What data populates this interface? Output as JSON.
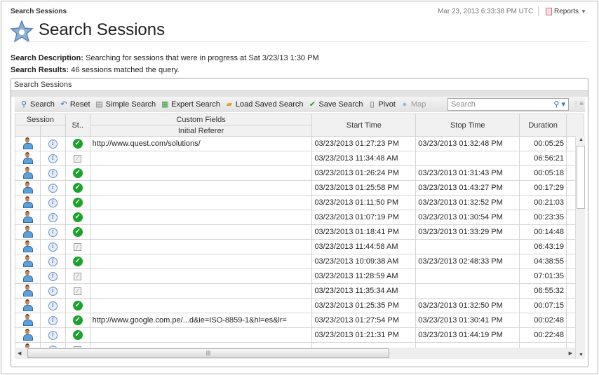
{
  "header": {
    "breadcrumb": "Search Sessions",
    "timestamp": "Mar 23, 2013 6:33:38 PM UTC",
    "reports_label": "Reports",
    "page_title": "Search Sessions"
  },
  "summary": {
    "desc_label": "Search Description:",
    "desc_value": "Searching for sessions that were in progress at Sat 3/23/13 1:30 PM",
    "results_label": "Search Results:",
    "results_value": "46 sessions matched the query."
  },
  "panel": {
    "title": "Search Sessions"
  },
  "toolbar": {
    "search": "Search",
    "reset": "Reset",
    "simple_search": "Simple Search",
    "expert_search": "Expert Search",
    "load_saved_search": "Load Saved Search",
    "save_search": "Save Search",
    "pivot": "Pivot",
    "map": "Map",
    "search_placeholder": "Search"
  },
  "columns": {
    "session": "Session",
    "status": "St..",
    "custom_fields": "Custom Fields",
    "initial_referer": "Initial Referer",
    "start_time": "Start Time",
    "stop_time": "Stop Time",
    "duration": "Duration"
  },
  "rows": [
    {
      "status": "ok",
      "referer": "http://www.quest.com/solutions/",
      "start": "03/23/2013 01:27:23 PM",
      "stop": "03/23/2013 01:32:48 PM",
      "duration": "00:05:25"
    },
    {
      "status": "pending",
      "referer": "",
      "start": "03/23/2013 11:34:48 AM",
      "stop": "",
      "duration": "06:56:21"
    },
    {
      "status": "ok",
      "referer": "",
      "start": "03/23/2013 01:26:24 PM",
      "stop": "03/23/2013 01:31:43 PM",
      "duration": "00:05:18"
    },
    {
      "status": "ok",
      "referer": "",
      "start": "03/23/2013 01:25:58 PM",
      "stop": "03/23/2013 01:43:27 PM",
      "duration": "00:17:29"
    },
    {
      "status": "ok",
      "referer": "",
      "start": "03/23/2013 01:11:50 PM",
      "stop": "03/23/2013 01:32:52 PM",
      "duration": "00:21:03"
    },
    {
      "status": "ok",
      "referer": "",
      "start": "03/23/2013 01:07:19 PM",
      "stop": "03/23/2013 01:30:54 PM",
      "duration": "00:23:35"
    },
    {
      "status": "ok",
      "referer": "",
      "start": "03/23/2013 01:18:41 PM",
      "stop": "03/23/2013 01:33:29 PM",
      "duration": "00:14:48"
    },
    {
      "status": "pending",
      "referer": "",
      "start": "03/23/2013 11:44:58 AM",
      "stop": "",
      "duration": "06:43:19"
    },
    {
      "status": "ok",
      "referer": "",
      "start": "03/23/2013 10:09:38 AM",
      "stop": "03/23/2013 02:48:33 PM",
      "duration": "04:38:55"
    },
    {
      "status": "pending",
      "referer": "",
      "start": "03/23/2013 11:28:59 AM",
      "stop": "",
      "duration": "07:01:35"
    },
    {
      "status": "pending",
      "referer": "",
      "start": "03/23/2013 11:35:34 AM",
      "stop": "",
      "duration": "06:55:32"
    },
    {
      "status": "ok",
      "referer": "",
      "start": "03/23/2013 01:25:35 PM",
      "stop": "03/23/2013 01:32:50 PM",
      "duration": "00:07:15"
    },
    {
      "status": "ok",
      "referer": "http://www.google.com.pe/...d&ie=ISO-8859-1&hl=es&lr=",
      "start": "03/23/2013 01:27:54 PM",
      "stop": "03/23/2013 01:30:41 PM",
      "duration": "00:02:48"
    },
    {
      "status": "ok",
      "referer": "",
      "start": "03/23/2013 01:21:31 PM",
      "stop": "03/23/2013 01:44:19 PM",
      "duration": "00:22:48"
    },
    {
      "status": "pending",
      "referer": "",
      "start": "",
      "stop": "",
      "duration": ""
    }
  ]
}
